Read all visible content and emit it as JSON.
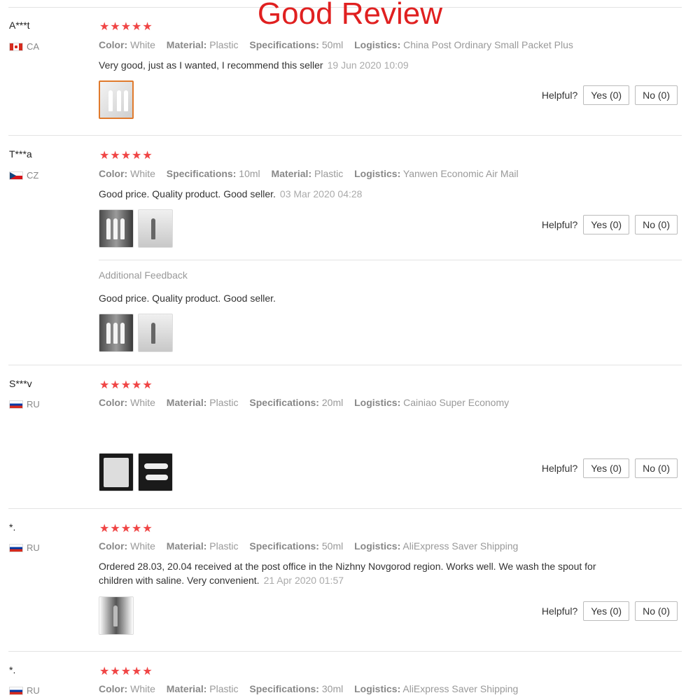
{
  "banner": "Good Review",
  "helpful_label": "Helpful?",
  "yes_label": "Yes (0)",
  "no_label": "No (0)",
  "star_color": "#f04545",
  "reviews": [
    {
      "user": "A***t",
      "country": "CA",
      "flag_icon": "canada-flag-icon",
      "stars": "★★★★★",
      "attrs": [
        {
          "k": "Color:",
          "v": "White"
        },
        {
          "k": "Material:",
          "v": "Plastic"
        },
        {
          "k": "Specifications:",
          "v": "50ml"
        },
        {
          "k": "Logistics:",
          "v": "China Post Ordinary Small Packet Plus"
        }
      ],
      "text": "Very good, just as I wanted, I recommend this seller",
      "date": "19 Jun 2020 10:09"
    },
    {
      "user": "T***a",
      "country": "CZ",
      "flag_icon": "czech-flag-icon",
      "stars": "★★★★★",
      "attrs": [
        {
          "k": "Color:",
          "v": "White"
        },
        {
          "k": "Specifications:",
          "v": "10ml"
        },
        {
          "k": "Material:",
          "v": "Plastic"
        },
        {
          "k": "Logistics:",
          "v": "Yanwen Economic Air Mail"
        }
      ],
      "text": "Good price. Quality product. Good seller.",
      "date": "03 Mar 2020 04:28",
      "additional_label": "Additional Feedback",
      "additional_text": "Good price. Quality product. Good seller."
    },
    {
      "user": "S***v",
      "country": "RU",
      "flag_icon": "russia-flag-icon",
      "stars": "★★★★★",
      "attrs": [
        {
          "k": "Color:",
          "v": "White"
        },
        {
          "k": "Material:",
          "v": "Plastic"
        },
        {
          "k": "Specifications:",
          "v": "20ml"
        },
        {
          "k": "Logistics:",
          "v": "Cainiao Super Economy"
        }
      ]
    },
    {
      "user": "*.",
      "country": "RU",
      "flag_icon": "russia-flag-icon",
      "stars": "★★★★★",
      "attrs": [
        {
          "k": "Color:",
          "v": "White"
        },
        {
          "k": "Material:",
          "v": "Plastic"
        },
        {
          "k": "Specifications:",
          "v": "50ml"
        },
        {
          "k": "Logistics:",
          "v": "AliExpress Saver Shipping"
        }
      ],
      "text": "Ordered 28.03, 20.04 received at the post office in the Nizhny Novgorod region. Works well. We wash the spout for children with saline. Very convenient.",
      "date": "21 Apr 2020 01:57"
    },
    {
      "user": "*.",
      "country": "RU",
      "flag_icon": "russia-flag-icon",
      "stars": "★★★★★",
      "attrs": [
        {
          "k": "Color:",
          "v": "White"
        },
        {
          "k": "Material:",
          "v": "Plastic"
        },
        {
          "k": "Specifications:",
          "v": "30ml"
        },
        {
          "k": "Logistics:",
          "v": "AliExpress Saver Shipping"
        }
      ]
    }
  ]
}
